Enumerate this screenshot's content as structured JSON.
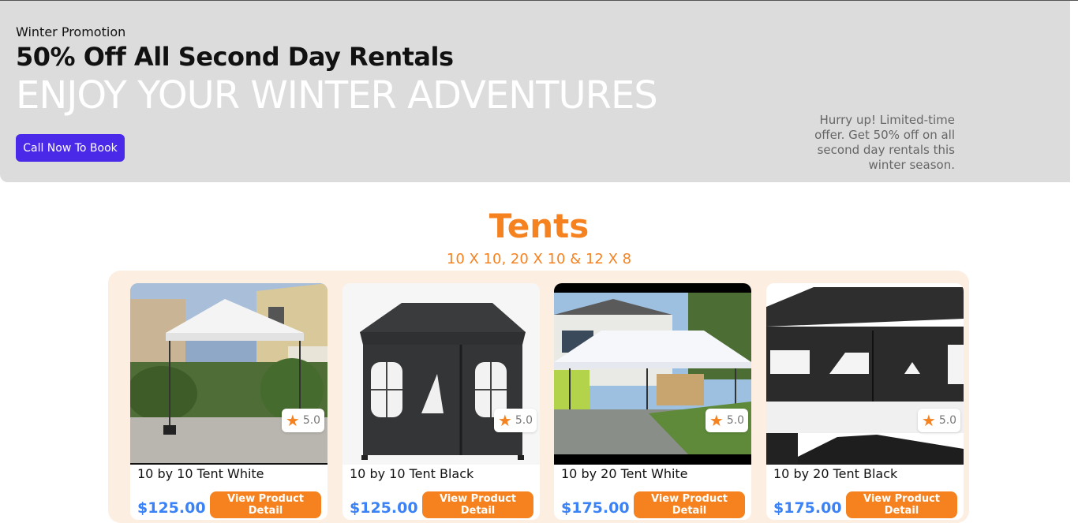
{
  "banner": {
    "eyebrow": "Winter Promotion",
    "title": "50% Off All Second Day Rentals",
    "hero": "ENJOY YOUR WINTER ADVENTURES",
    "cta_label": "Call Now To Book",
    "note": "Hurry up! Limited-time offer. Get 50% off on all second day rentals this winter season."
  },
  "section": {
    "title": "Tents",
    "subtitle": "10 X 10, 20 X 10 & 12 X 8"
  },
  "products": [
    {
      "name": "10 by 10 Tent White",
      "price": "$125.00",
      "rating": "5.0",
      "button": "View Product Detail"
    },
    {
      "name": "10 by 10 Tent Black",
      "price": "$125.00",
      "rating": "5.0",
      "button": "View Product Detail"
    },
    {
      "name": "10 by 20 Tent White",
      "price": "$175.00",
      "rating": "5.0",
      "button": "View Product Detail"
    },
    {
      "name": "10 by 20 Tent Black",
      "price": "$175.00",
      "rating": "5.0",
      "button": "View Product Detail"
    }
  ],
  "icons": {
    "rating": "star-icon"
  },
  "colors": {
    "accent": "#f5821f",
    "cta": "#4a2ae8",
    "price": "#3b82f6",
    "banner": "#dcdcdc"
  }
}
